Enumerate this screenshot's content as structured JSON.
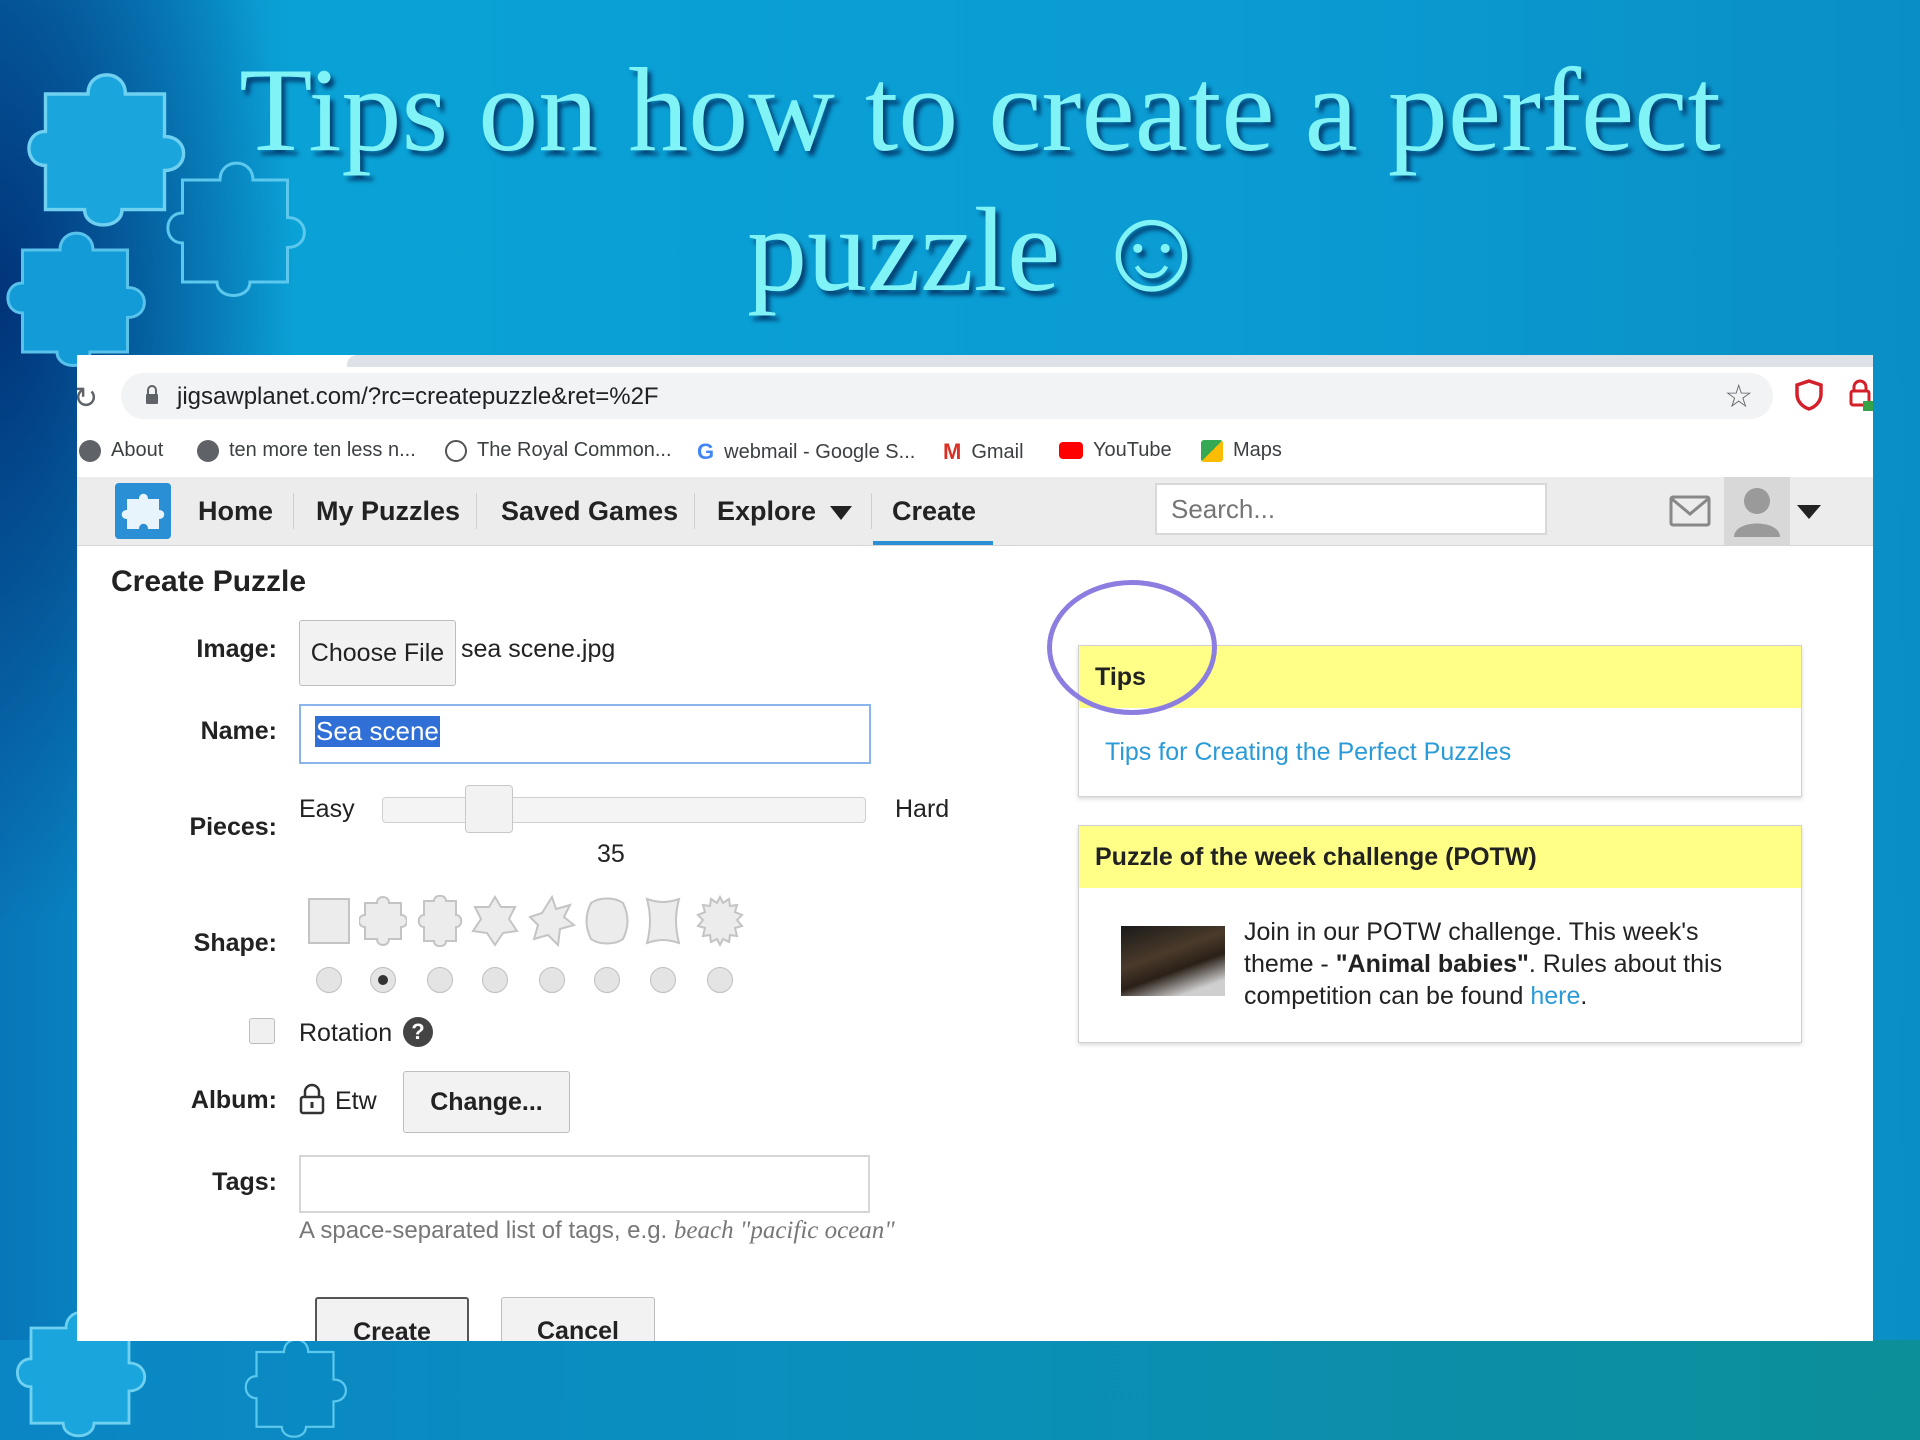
{
  "slide": {
    "title_line1": "Tips on how to create a perfect",
    "title_line2": "puzzle ☺"
  },
  "browser": {
    "url": "jigsawplanet.com/?rc=createpuzzle&ret=%2F",
    "bookmarks": [
      {
        "label": "About",
        "icon": "globe-icon"
      },
      {
        "label": "ten more ten less n...",
        "icon": "globe-icon"
      },
      {
        "label": "The Royal Common...",
        "icon": "royal-crest-icon"
      },
      {
        "label": "webmail - Google S...",
        "icon": "google-icon"
      },
      {
        "label": "Gmail",
        "icon": "gmail-icon"
      },
      {
        "label": "YouTube",
        "icon": "youtube-icon"
      },
      {
        "label": "Maps",
        "icon": "maps-icon"
      }
    ]
  },
  "site_nav": {
    "items": [
      "Home",
      "My Puzzles",
      "Saved Games",
      "Explore",
      "Create"
    ],
    "active": "Create",
    "search_placeholder": "Search..."
  },
  "form": {
    "page_title": "Create Puzzle",
    "image_label": "Image:",
    "choose_file_label": "Choose File",
    "file_name": "sea scene.jpg",
    "name_label": "Name:",
    "name_value": "Sea scene",
    "pieces_label": "Pieces:",
    "easy_label": "Easy",
    "hard_label": "Hard",
    "pieces_value": "35",
    "shape_label": "Shape:",
    "selected_shape_index": 1,
    "rotation_label": "Rotation",
    "rotation_checked": false,
    "album_label": "Album:",
    "album_value": "Etw",
    "change_label": "Change...",
    "tags_label": "Tags:",
    "tags_value": "",
    "tags_hint_prefix": "A space-separated list of tags, e.g.",
    "tags_hint_example": "beach \"pacific ocean\"",
    "create_label": "Create",
    "cancel_label": "Cancel"
  },
  "tips_card": {
    "title": "Tips",
    "link_text": "Tips for Creating the Perfect Puzzles"
  },
  "potw_card": {
    "title": "Puzzle of the week challenge (POTW)",
    "text_1": "Join in our POTW challenge. This week's theme - ",
    "text_bold": "\"Animal babies\"",
    "text_2": ". Rules about this competition can be found ",
    "link_text": "here",
    "text_3": "."
  },
  "colors": {
    "title": "#7ff3f6",
    "accent": "#2a8fd4",
    "highlight_circle": "#8c7ee0",
    "card_header": "#ffff88",
    "link": "#2a9ad8"
  }
}
